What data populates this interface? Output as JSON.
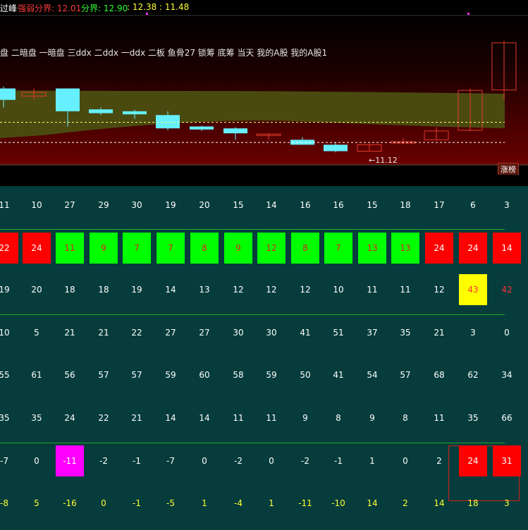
{
  "header": {
    "title_fragment": "过峰",
    "strong_label": "强弱分界: 12.01",
    "boundary_label": "分界: 12.90",
    "values_label": ": 12.38 : 11.48",
    "colors": {
      "title": "#ffffff",
      "strong": "#ff3b3b",
      "boundary": "#33ff33",
      "values": "#ffff33"
    }
  },
  "indicators": "盘 二暗盘 一暗盘 三ddx 二ddx 一ddx 二板 鱼骨27 锁筹 底筹 当天 我的A股 我的A股1",
  "low_label": "←11.12",
  "zhangbang_label": "涨榜",
  "chart_data": {
    "type": "candlestick",
    "candles": [
      {
        "o": 12.6,
        "c": 12.9,
        "h": 12.95,
        "l": 12.4,
        "up": false
      },
      {
        "o": 12.8,
        "c": 12.7,
        "h": 12.9,
        "l": 12.6,
        "up": true
      },
      {
        "o": 12.9,
        "c": 12.3,
        "h": 12.9,
        "l": 11.9,
        "up": false
      },
      {
        "o": 12.35,
        "c": 12.25,
        "h": 12.4,
        "l": 12.2,
        "up": false
      },
      {
        "o": 12.3,
        "c": 12.22,
        "h": 12.34,
        "l": 12.1,
        "up": false
      },
      {
        "o": 12.2,
        "c": 11.85,
        "h": 12.3,
        "l": 11.8,
        "up": false
      },
      {
        "o": 11.9,
        "c": 11.82,
        "h": 11.92,
        "l": 11.78,
        "up": false
      },
      {
        "o": 11.85,
        "c": 11.72,
        "h": 11.88,
        "l": 11.55,
        "up": false
      },
      {
        "o": 11.7,
        "c": 11.67,
        "h": 11.72,
        "l": 11.55,
        "up": true
      },
      {
        "o": 11.55,
        "c": 11.42,
        "h": 11.62,
        "l": 11.42,
        "up": false
      },
      {
        "o": 11.42,
        "c": 11.25,
        "h": 11.48,
        "l": 11.22,
        "up": false
      },
      {
        "o": 11.25,
        "c": 11.42,
        "h": 11.45,
        "l": 11.25,
        "up": true
      },
      {
        "o": 11.47,
        "c": 11.5,
        "h": 11.6,
        "l": 11.44,
        "up": true
      },
      {
        "o": 11.55,
        "c": 11.78,
        "h": 11.88,
        "l": 11.55,
        "up": true
      },
      {
        "o": 11.8,
        "c": 12.85,
        "h": 12.9,
        "l": 11.78,
        "up": true
      },
      {
        "o": 12.86,
        "c": 14.1,
        "h": 14.15,
        "l": 12.6,
        "up": true
      }
    ],
    "levels": [
      12.01,
      11.48
    ]
  },
  "table": {
    "rows": [
      {
        "values": [
          "11",
          "10",
          "27",
          "29",
          "30",
          "19",
          "20",
          "15",
          "14",
          "16",
          "16",
          "15",
          "18",
          "17",
          "6",
          "3"
        ]
      },
      {
        "values": [
          "22",
          "24",
          "11",
          "9",
          "7",
          "7",
          "8",
          "9",
          "12",
          "8",
          "7",
          "13",
          "13",
          "24",
          "24",
          "14"
        ],
        "fills": [
          "red",
          "red",
          "green",
          "green",
          "green",
          "green",
          "green",
          "green",
          "green",
          "green",
          "green",
          "green",
          "green",
          "red",
          "red",
          "red"
        ]
      },
      {
        "values": [
          "19",
          "20",
          "18",
          "18",
          "19",
          "14",
          "13",
          "12",
          "12",
          "12",
          "10",
          "11",
          "11",
          "12",
          "43",
          "42"
        ],
        "fills": [
          "",
          "",
          "",
          "",
          "",
          "",
          "",
          "",
          "",
          "",
          "",
          "",
          "",
          "",
          "yellow",
          ""
        ],
        "textcolors": [
          "",
          "",
          "",
          "",
          "",
          "",
          "",
          "",
          "",
          "",
          "",
          "",
          "",
          "",
          "red",
          "red"
        ]
      },
      {
        "values": [
          "10",
          "5",
          "21",
          "21",
          "22",
          "27",
          "27",
          "30",
          "30",
          "41",
          "51",
          "37",
          "35",
          "21",
          "3",
          "0"
        ]
      },
      {
        "values": [
          "55",
          "61",
          "56",
          "57",
          "57",
          "59",
          "60",
          "58",
          "59",
          "50",
          "41",
          "54",
          "57",
          "68",
          "62",
          "34"
        ]
      },
      {
        "values": [
          "35",
          "35",
          "24",
          "22",
          "21",
          "14",
          "14",
          "11",
          "11",
          "9",
          "8",
          "9",
          "8",
          "11",
          "35",
          "66"
        ]
      },
      {
        "values": [
          "-7",
          "0",
          "-11",
          "-2",
          "-1",
          "-7",
          "0",
          "-2",
          "0",
          "-2",
          "-1",
          "1",
          "0",
          "2",
          "24",
          "31"
        ],
        "fills": [
          "",
          "",
          "magenta",
          "",
          "",
          "",
          "",
          "",
          "",
          "",
          "",
          "",
          "",
          "",
          "red",
          "red"
        ]
      },
      {
        "values": [
          "-8",
          "5",
          "-16",
          "0",
          "-1",
          "-5",
          "1",
          "-4",
          "1",
          "-11",
          "-10",
          "14",
          "2",
          "14",
          "18",
          "3"
        ],
        "textcolors": [
          "yellow",
          "yellow",
          "yellow",
          "yellow",
          "yellow",
          "yellow",
          "yellow",
          "yellow",
          "yellow",
          "yellow",
          "yellow",
          "yellow",
          "yellow",
          "yellow",
          "yellow",
          "yellow"
        ]
      }
    ]
  }
}
